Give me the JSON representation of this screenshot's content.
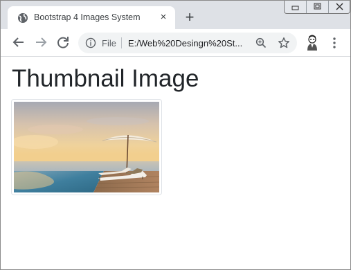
{
  "browser": {
    "tab": {
      "title": "Bootstrap 4 Images System",
      "favicon": "globe-icon",
      "close": "×"
    },
    "new_tab": "+",
    "window_controls": [
      "minimize-icon",
      "restore-icon",
      "close-icon"
    ],
    "nav": {
      "back": "back-arrow-icon",
      "forward": "forward-arrow-icon",
      "reload": "reload-icon"
    },
    "address": {
      "scheme_label": "File",
      "url": "E:/Web%20Desingn%20St..."
    },
    "toolbar_icons": [
      "zoom-icon",
      "star-icon",
      "avatar",
      "menu-icon"
    ]
  },
  "page": {
    "heading": "Thumbnail Image",
    "thumbnail": {
      "subject": "beach-umbrella-photo"
    }
  },
  "colors": {
    "tabstrip": "#dee1e6",
    "omnibox": "#f1f3f4",
    "heading": "#212529",
    "thumbnail_border": "#dee2e6"
  }
}
